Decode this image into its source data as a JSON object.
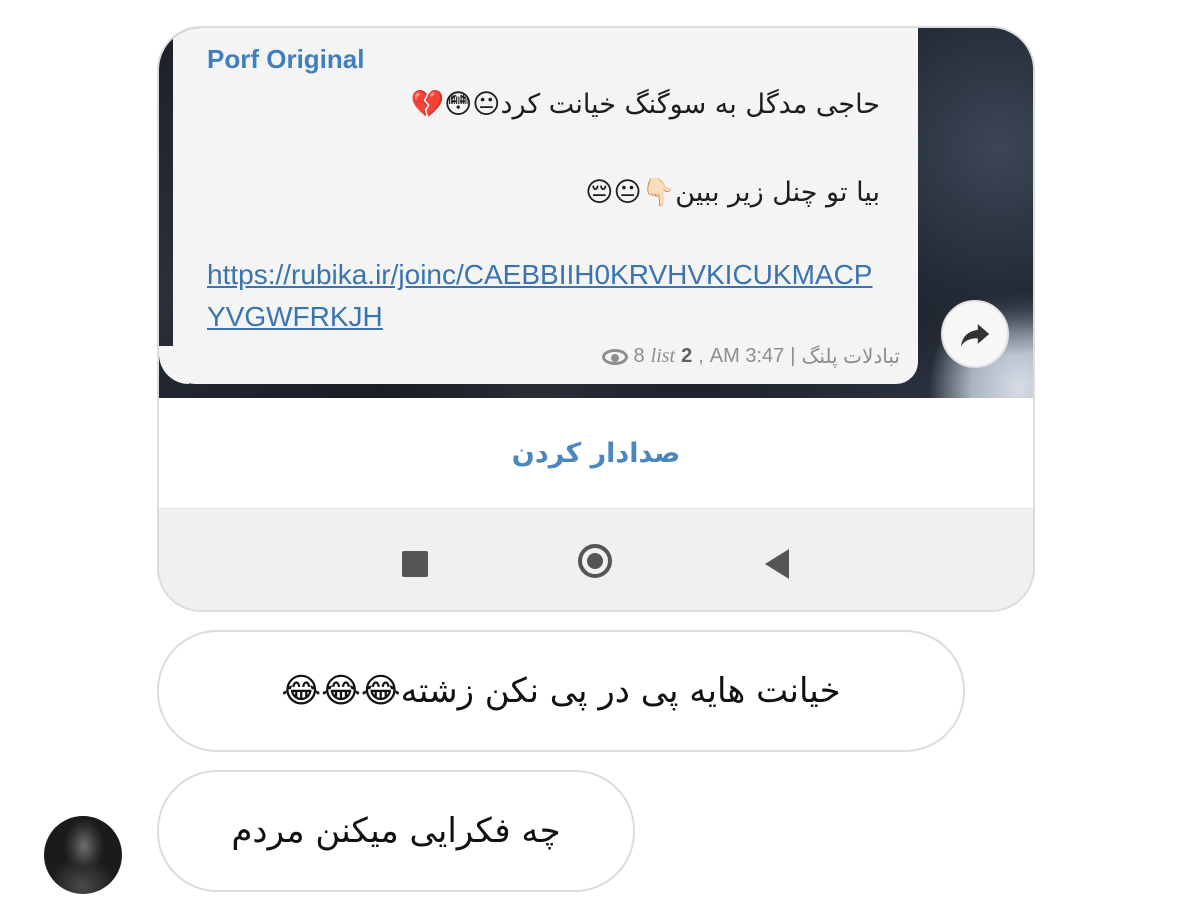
{
  "shared_screenshot": {
    "message": {
      "sender": "Porf Original",
      "line1": "حاجی مدگل به سوگنگ خیانت کرد😐😳💔",
      "line2": "بیا تو چنل زیر ببین👇🏻😐😔",
      "link": "https://rubika.ir/joinc/CAEBBIIH0KRVHVKICUKMACPYVGWFRKJH",
      "channel": "تبادلات پلنگ",
      "time": "3:47 AM",
      "list_label": "list",
      "list_number": "2",
      "views": "8"
    },
    "unmute_label": "صدادار کردن",
    "icons": {
      "forward": "forward-arrow-icon",
      "views": "eye-icon",
      "nav": [
        "recents-square-icon",
        "home-circle-icon",
        "back-triangle-icon"
      ]
    }
  },
  "replies": [
    {
      "text": "خیانت هایه پی در پی نکن زشته😂😂😂"
    },
    {
      "text": "چه فکرایی میکنن مردم"
    }
  ],
  "colors": {
    "accent": "#3f7fbf",
    "link": "#3a74b0",
    "meta": "#8d8d8d"
  }
}
